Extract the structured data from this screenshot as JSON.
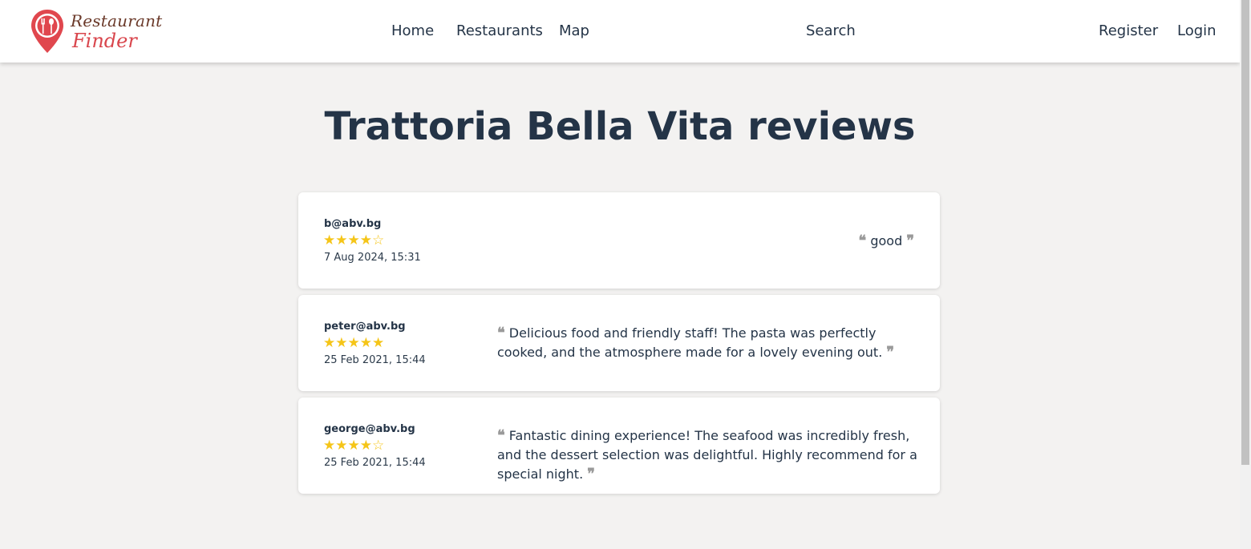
{
  "logo": {
    "line1": "Restaurant",
    "line2": "Finder"
  },
  "nav": {
    "home": "Home",
    "restaurants": "Restaurants",
    "map": "Map",
    "search": "Search",
    "register": "Register",
    "login": "Login"
  },
  "page": {
    "title": "Trattoria Bella Vita reviews"
  },
  "colors": {
    "star": "#f5c518",
    "text": "#243447",
    "background": "#f3f2f1",
    "brand_red": "#d9464d"
  },
  "reviews": [
    {
      "user": "b@abv.bg",
      "rating": 4,
      "max_rating": 5,
      "date": "7 Aug 2024, 15:31",
      "text": "good"
    },
    {
      "user": "peter@abv.bg",
      "rating": 5,
      "max_rating": 5,
      "date": "25 Feb 2021, 15:44",
      "text": "Delicious food and friendly staff! The pasta was perfectly cooked, and the atmosphere made for a lovely evening out."
    },
    {
      "user": "george@abv.bg",
      "rating": 4,
      "max_rating": 5,
      "date": "25 Feb 2021, 15:44",
      "text": "Fantastic dining experience! The seafood was incredibly fresh, and the dessert selection was delightful. Highly recommend for a special night."
    }
  ]
}
